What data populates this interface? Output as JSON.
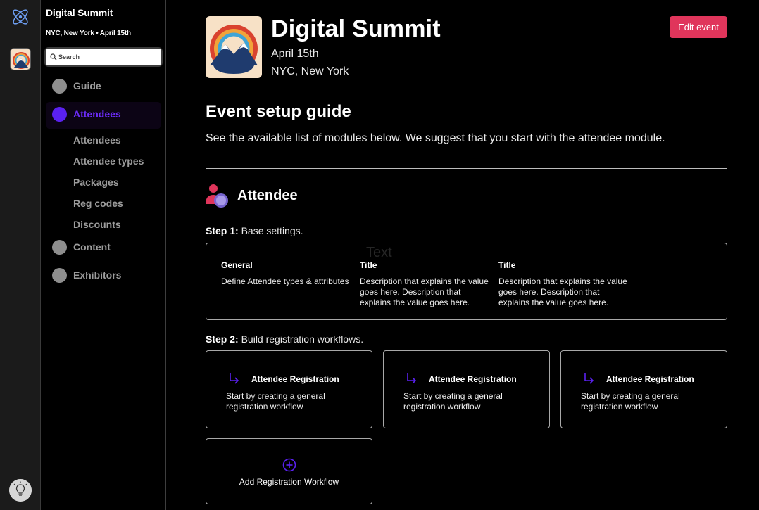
{
  "sidebar": {
    "event_name": "Digital Summit",
    "event_meta": "NYC, New York • April 15th",
    "search_placeholder": "Search",
    "nav": [
      {
        "label": "Guide"
      },
      {
        "label": "Attendees"
      },
      {
        "label": "Content"
      },
      {
        "label": "Exhibitors"
      }
    ],
    "sub_items": [
      "Attendees",
      "Attendee types",
      "Packages",
      "Reg codes",
      "Discounts"
    ]
  },
  "header": {
    "title": "Digital Summit",
    "date": "April 15th",
    "location": "NYC, New York",
    "edit_label": "Edit event"
  },
  "guide": {
    "title": "Event setup guide",
    "description": "See the available list of modules below. We suggest that you start with the attendee module."
  },
  "module": {
    "title": "Attendee",
    "step1_label": "Step 1:",
    "step1_text": "Base settings.",
    "step1_ghost": "Text",
    "step1_columns": [
      {
        "title": "General",
        "desc": "Define Attendee types & attributes"
      },
      {
        "title": "Title",
        "desc": "Description that explains the value goes here. Description that explains the value goes here."
      },
      {
        "title": "Title",
        "desc": "Description that explains the value goes here. Description that explains the value goes here."
      }
    ],
    "step2_label": "Step 2:",
    "step2_text": "Build registration workflows.",
    "workflows": [
      {
        "title": "Attendee Registration",
        "desc": "Start by creating a general registration workflow"
      },
      {
        "title": "Attendee Registration",
        "desc": "Start by creating a general registration workflow"
      },
      {
        "title": "Attendee Registration",
        "desc": "Start by creating a general registration workflow"
      }
    ],
    "add_workflow_label": "Add Registration Workflow"
  },
  "colors": {
    "accent_purple": "#5a21f0",
    "edit_button": "#e0355b"
  },
  "icons": [
    "atom-icon",
    "event-logo-icon",
    "lightbulb-icon",
    "search-icon",
    "attendee-module-icon",
    "arrow-down-right-icon",
    "plus-circle-icon"
  ]
}
